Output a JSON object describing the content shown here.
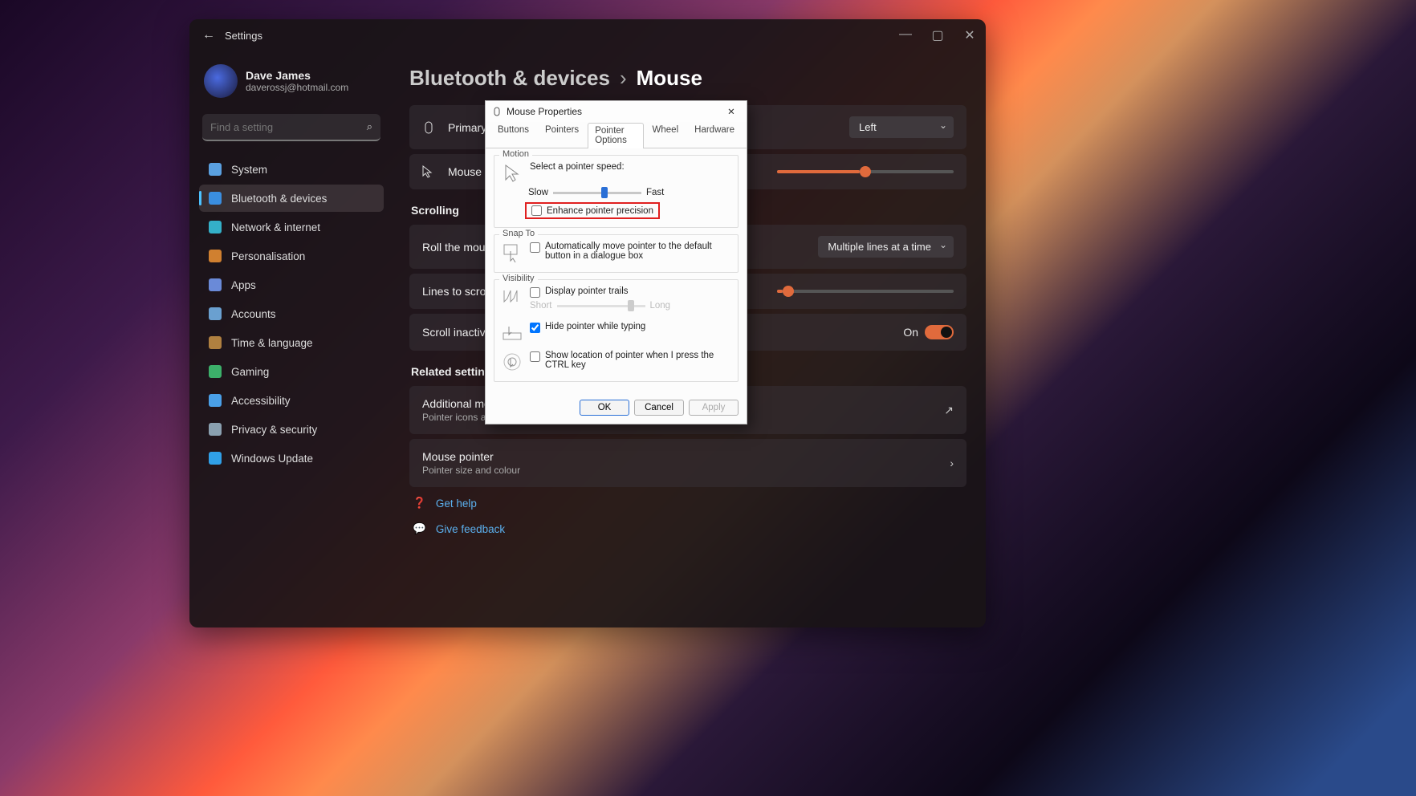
{
  "window": {
    "title": "Settings",
    "user_name": "Dave James",
    "user_email": "daverossj@hotmail.com",
    "search_placeholder": "Find a setting"
  },
  "nav": [
    {
      "label": "System",
      "icon": "monitor-icon"
    },
    {
      "label": "Bluetooth & devices",
      "icon": "bluetooth-icon",
      "active": true
    },
    {
      "label": "Network & internet",
      "icon": "wifi-icon"
    },
    {
      "label": "Personalisation",
      "icon": "brush-icon"
    },
    {
      "label": "Apps",
      "icon": "apps-icon"
    },
    {
      "label": "Accounts",
      "icon": "person-icon"
    },
    {
      "label": "Time & language",
      "icon": "clock-icon"
    },
    {
      "label": "Gaming",
      "icon": "gamepad-icon"
    },
    {
      "label": "Accessibility",
      "icon": "accessibility-icon"
    },
    {
      "label": "Privacy & security",
      "icon": "shield-icon"
    },
    {
      "label": "Windows Update",
      "icon": "update-icon"
    }
  ],
  "breadcrumb": {
    "parent": "Bluetooth & devices",
    "current": "Mouse"
  },
  "rows": {
    "primary": {
      "label": "Primary m",
      "value": "Left"
    },
    "speed": {
      "label": "Mouse po",
      "slider_pct": 47
    },
    "roll": {
      "label": "Roll the mouse w",
      "value": "Multiple lines at a time"
    },
    "lines": {
      "label": "Lines to scroll at",
      "slider_pct": 3
    },
    "inactive": {
      "label": "Scroll inactive wi",
      "toggle_label": "On"
    },
    "additional": {
      "title": "Additional mouse settings",
      "sub": "Pointer icons and visibility"
    },
    "pointer": {
      "title": "Mouse pointer",
      "sub": "Pointer size and colour"
    }
  },
  "sections": {
    "scrolling": "Scrolling",
    "related": "Related settings"
  },
  "help": {
    "get_help": "Get help",
    "feedback": "Give feedback"
  },
  "dialog": {
    "title": "Mouse Properties",
    "tabs": [
      "Buttons",
      "Pointers",
      "Pointer Options",
      "Wheel",
      "Hardware"
    ],
    "active_tab": "Pointer Options",
    "motion": {
      "group": "Motion",
      "select_label": "Select a pointer speed:",
      "slow": "Slow",
      "fast": "Fast",
      "speed_pct": 55,
      "enhance": "Enhance pointer precision"
    },
    "snap": {
      "group": "Snap To",
      "auto_label": "Automatically move pointer to the default button in a dialogue box"
    },
    "visibility": {
      "group": "Visibility",
      "trails": "Display pointer trails",
      "short": "Short",
      "long": "Long",
      "trail_pct": 80,
      "hide": "Hide pointer while typing",
      "ctrl": "Show location of pointer when I press the CTRL key"
    },
    "buttons": {
      "ok": "OK",
      "cancel": "Cancel",
      "apply": "Apply"
    }
  }
}
